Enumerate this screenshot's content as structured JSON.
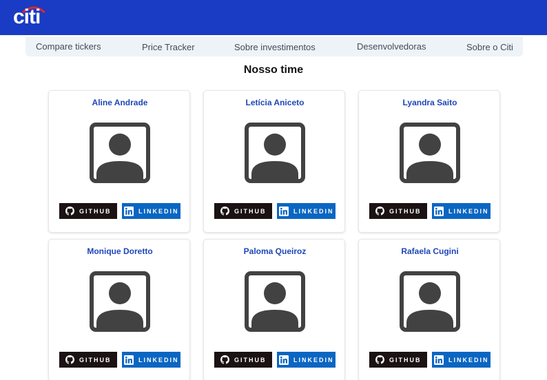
{
  "header": {
    "brand": "citi",
    "brand_color": "#1a3bc4",
    "accent": "#e3262b"
  },
  "nav": {
    "items": [
      {
        "label": "Compare tickers"
      },
      {
        "label": "Price Tracker"
      },
      {
        "label": "Sobre investimentos"
      },
      {
        "label": "Desenvolvedoras"
      },
      {
        "label": "Sobre o Citi"
      }
    ]
  },
  "section": {
    "title": "Nosso time"
  },
  "team": [
    {
      "name": "Aline Andrade",
      "github_label": "GITHUB",
      "linkedin_label": "LINKEDIN"
    },
    {
      "name": "Letícia Aniceto",
      "github_label": "GITHUB",
      "linkedin_label": "LINKEDIN"
    },
    {
      "name": "Lyandra Saito",
      "github_label": "GITHUB",
      "linkedin_label": "LINKEDIN"
    },
    {
      "name": "Monique Doretto",
      "github_label": "GITHUB",
      "linkedin_label": "LINKEDIN"
    },
    {
      "name": "Paloma Queiroz",
      "github_label": "GITHUB",
      "linkedin_label": "LINKEDIN"
    },
    {
      "name": "Rafaela Cugini",
      "github_label": "GITHUB",
      "linkedin_label": "LINKEDIN"
    }
  ],
  "icons": {
    "github": "github-icon",
    "linkedin": "linkedin-icon",
    "avatar": "account-box-icon"
  }
}
